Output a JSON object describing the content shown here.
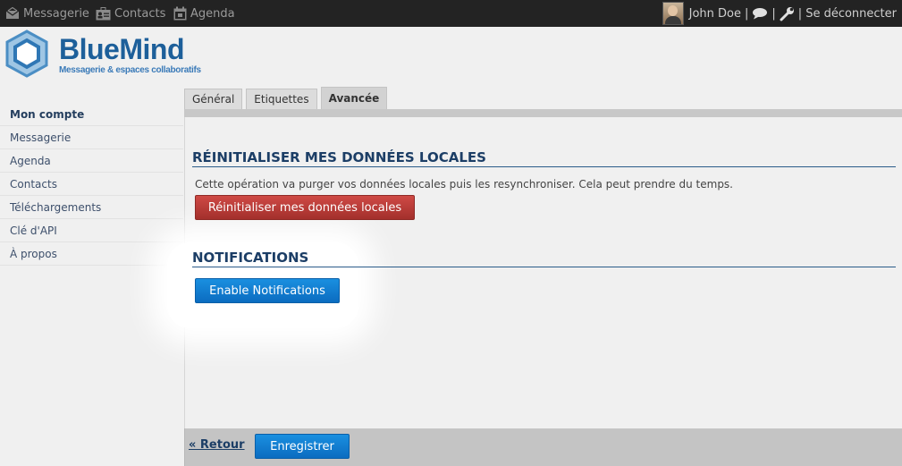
{
  "topbar": {
    "apps": [
      {
        "label": "Messagerie",
        "icon": "mail-icon"
      },
      {
        "label": "Contacts",
        "icon": "contacts-icon"
      },
      {
        "label": "Agenda",
        "icon": "calendar-icon"
      }
    ],
    "user_name": "John Doe",
    "separator": "|",
    "logout_label": "Se déconnecter"
  },
  "logo": {
    "name": "BlueMind",
    "tagline": "Messagerie & espaces collaboratifs"
  },
  "sidebar": {
    "items": [
      {
        "label": "Mon compte"
      },
      {
        "label": "Messagerie"
      },
      {
        "label": "Agenda"
      },
      {
        "label": "Contacts"
      },
      {
        "label": "Téléchargements"
      },
      {
        "label": "Clé d'API"
      },
      {
        "label": "À propos"
      }
    ]
  },
  "tabs": [
    {
      "label": "Général"
    },
    {
      "label": "Etiquettes"
    },
    {
      "label": "Avancée"
    }
  ],
  "sections": {
    "reset": {
      "title": "RÉINITIALISER MES DONNÉES LOCALES",
      "description": "Cette opération va purger vos données locales puis les resynchroniser. Cela peut prendre du temps.",
      "button_label": "Réinitialiser mes données locales"
    },
    "notifications": {
      "title": "NOTIFICATIONS",
      "button_label": "Enable Notifications"
    }
  },
  "footer": {
    "back_label": "« Retour",
    "save_label": "Enregistrer"
  },
  "colors": {
    "topbar_bg": "#232323",
    "brand_blue": "#1d5f9a",
    "danger": "#b83a36",
    "primary": "#0b7dd2"
  }
}
